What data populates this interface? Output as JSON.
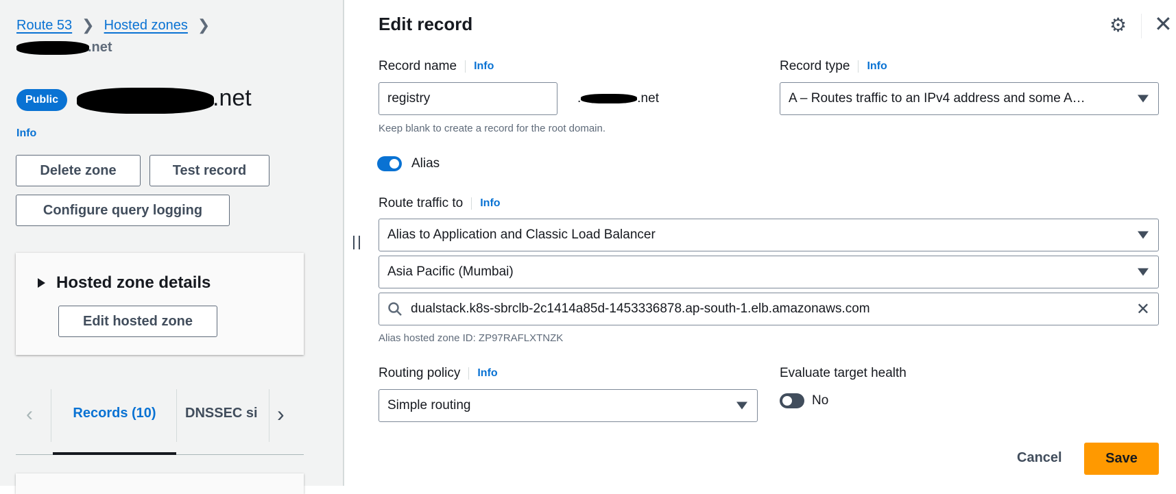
{
  "breadcrumb": {
    "items": [
      "Route 53",
      "Hosted zones"
    ],
    "current": ".net"
  },
  "zone": {
    "badge": "Public",
    "name_suffix": ".net",
    "info": "Info"
  },
  "actions": {
    "delete": "Delete zone",
    "test": "Test record",
    "logging": "Configure query logging"
  },
  "details": {
    "title": "Hosted zone details",
    "edit": "Edit hosted zone"
  },
  "tabs": {
    "items": [
      "Records (10)",
      "DNSSEC si"
    ],
    "active": 0
  },
  "panel": {
    "title": "Edit record",
    "record_name": {
      "label": "Record name",
      "info": "Info",
      "value": "registry",
      "suffix": ".net",
      "hint": "Keep blank to create a record for the root domain."
    },
    "record_type": {
      "label": "Record type",
      "info": "Info",
      "value": "A – Routes traffic to an IPv4 address and some A…"
    },
    "alias": {
      "label": "Alias",
      "enabled": true
    },
    "route_traffic": {
      "label": "Route traffic to",
      "info": "Info",
      "endpoint": "Alias to Application and Classic Load Balancer",
      "region": "Asia Pacific (Mumbai)",
      "target": "dualstack.k8s-sbrclb-2c1414a85d-1453336878.ap-south-1.elb.amazonaws.com",
      "zone_id": "Alias hosted zone ID: ZP97RAFLXTNZK"
    },
    "routing_policy": {
      "label": "Routing policy",
      "info": "Info",
      "value": "Simple routing"
    },
    "evaluate_health": {
      "label": "Evaluate target health",
      "value": "No",
      "enabled": false
    },
    "cancel": "Cancel",
    "save": "Save"
  },
  "colors": {
    "accent": "#0972d3",
    "save": "#ff9900",
    "toggle_off": "#414d5c"
  }
}
